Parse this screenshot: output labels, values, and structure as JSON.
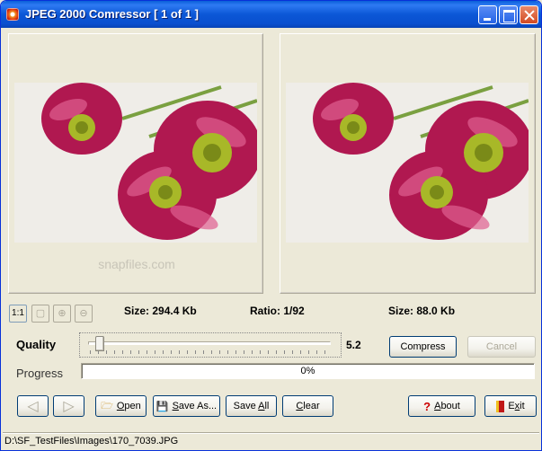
{
  "window": {
    "title": "JPEG 2000 Comressor [ 1 of 1 ]",
    "accent": "#0a5fd8",
    "titlebar_buttons": [
      "minimize-icon",
      "maximize-icon",
      "close-icon"
    ]
  },
  "preview": {
    "watermark": "snapfiles.com"
  },
  "toolbar": {
    "actual_size_label": "1:1",
    "icons": [
      "fit-window-icon",
      "zoom-in-icon",
      "zoom-out-icon"
    ]
  },
  "info": {
    "original_size": "Size:  294.4 Kb",
    "ratio": "Ratio: 1/92",
    "compressed_size": "Size:   88.0 Kb"
  },
  "quality": {
    "label": "Quality",
    "value": "5.2",
    "slider_fraction": 0.03
  },
  "progress": {
    "label": "Progress",
    "text": "0%",
    "value": 0
  },
  "buttons": {
    "compress": "Compress",
    "cancel": "Cancel",
    "open_pre": "",
    "open_u": "O",
    "open_post": "pen",
    "saveas_pre": "",
    "saveas_u": "S",
    "saveas_post": "ave As...",
    "saveall_pre": "Save ",
    "saveall_u": "A",
    "saveall_post": "ll",
    "clear_pre": "",
    "clear_u": "C",
    "clear_post": "lear",
    "about_pre": "",
    "about_u": "A",
    "about_post": "bout",
    "exit_pre": "E",
    "exit_u": "x",
    "exit_post": "it"
  },
  "status": {
    "path": "D:\\SF_TestFiles\\Images\\170_7039.JPG"
  }
}
